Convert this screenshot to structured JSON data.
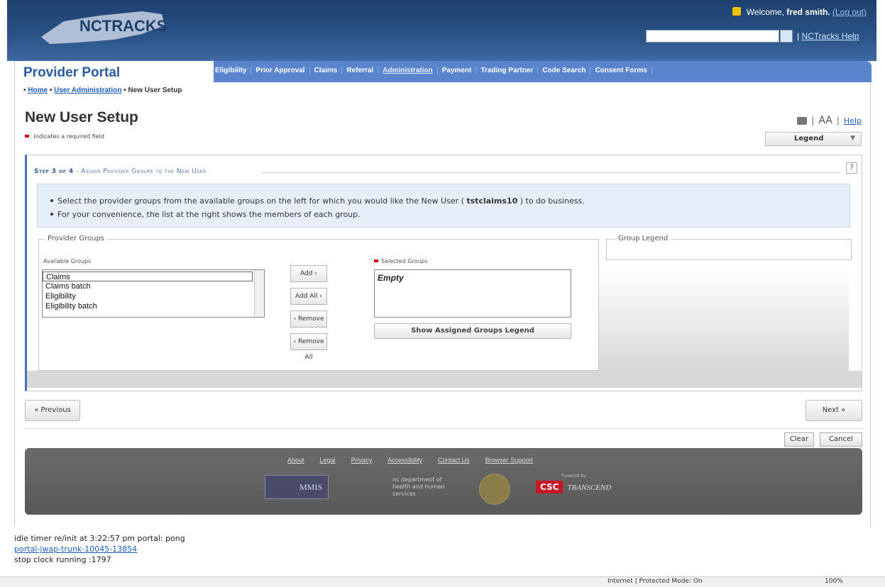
{
  "header": {
    "logo_text": "NCTRACKS",
    "welcome_prefix": "Welcome,",
    "user_name": "fred smith.",
    "logout": "(Log out)",
    "help_link": "NCTracks Help",
    "help_sep": "|"
  },
  "portal": {
    "title": "Provider Portal",
    "nav": [
      "Eligibility",
      "Prior Approval",
      "Claims",
      "Referral",
      "Administration",
      "Payment",
      "Trading Partner",
      "Code Search",
      "Consent Forms"
    ]
  },
  "breadcrumb": {
    "home": "Home",
    "user_admin": "User Administration",
    "current": "New User Setup"
  },
  "page": {
    "title": "New User Setup",
    "required_note": "indicates a required field",
    "tools_aa": "AA",
    "help": "Help",
    "legend": "Legend"
  },
  "step": {
    "prefix": "Step 3 of 4",
    "desc": " - Assign Provider Groups to the New User",
    "help": "?",
    "info_line1_a": "Select the provider groups from the available groups on the left for which you would like the New User ( ",
    "user_id": "tstclaims10",
    "info_line1_b": " ) to do business.",
    "info_line2": "For your convenience, the list at the right shows the members of each group."
  },
  "groups": {
    "panel_label": "Provider Groups",
    "available_label": "Available Groups",
    "available": [
      "Claims",
      "Claims batch",
      "Eligibility",
      "Eligibility batch"
    ],
    "selected_label": "Selected Groups",
    "selected_empty": "Empty",
    "add": "Add ›",
    "add_all": "Add All ›",
    "remove": "‹ Remove",
    "remove_all": "‹ Remove All",
    "show_legend": "Show Assigned Groups Legend",
    "legend_label": "Group Legend"
  },
  "actions": {
    "previous": "« Previous",
    "next": "Next »",
    "clear": "Clear",
    "cancel": "Cancel"
  },
  "footer": {
    "links": [
      "About",
      "Legal",
      "Privacy",
      "Accessibility",
      "Contact Us",
      "Browser Support"
    ],
    "mmis": "MMIS",
    "dhhs": "nc department of health and human services",
    "powered": "Powered By",
    "csc": "CSC",
    "transcend": "TRANSCEND"
  },
  "status": {
    "line1": "idle timer re/init at 3:22:57 pm   portal: pong",
    "line2": "portal-jwap-trunk-10045-13854",
    "line3": "stop clock running :1797"
  },
  "browser": {
    "zone": "Internet | Protected Mode: On",
    "zoom": "100%"
  },
  "colors": {
    "header": "#2b5386",
    "nav": "#5a84cc",
    "info_bg": "#e6eef9",
    "footer": "#616161"
  }
}
